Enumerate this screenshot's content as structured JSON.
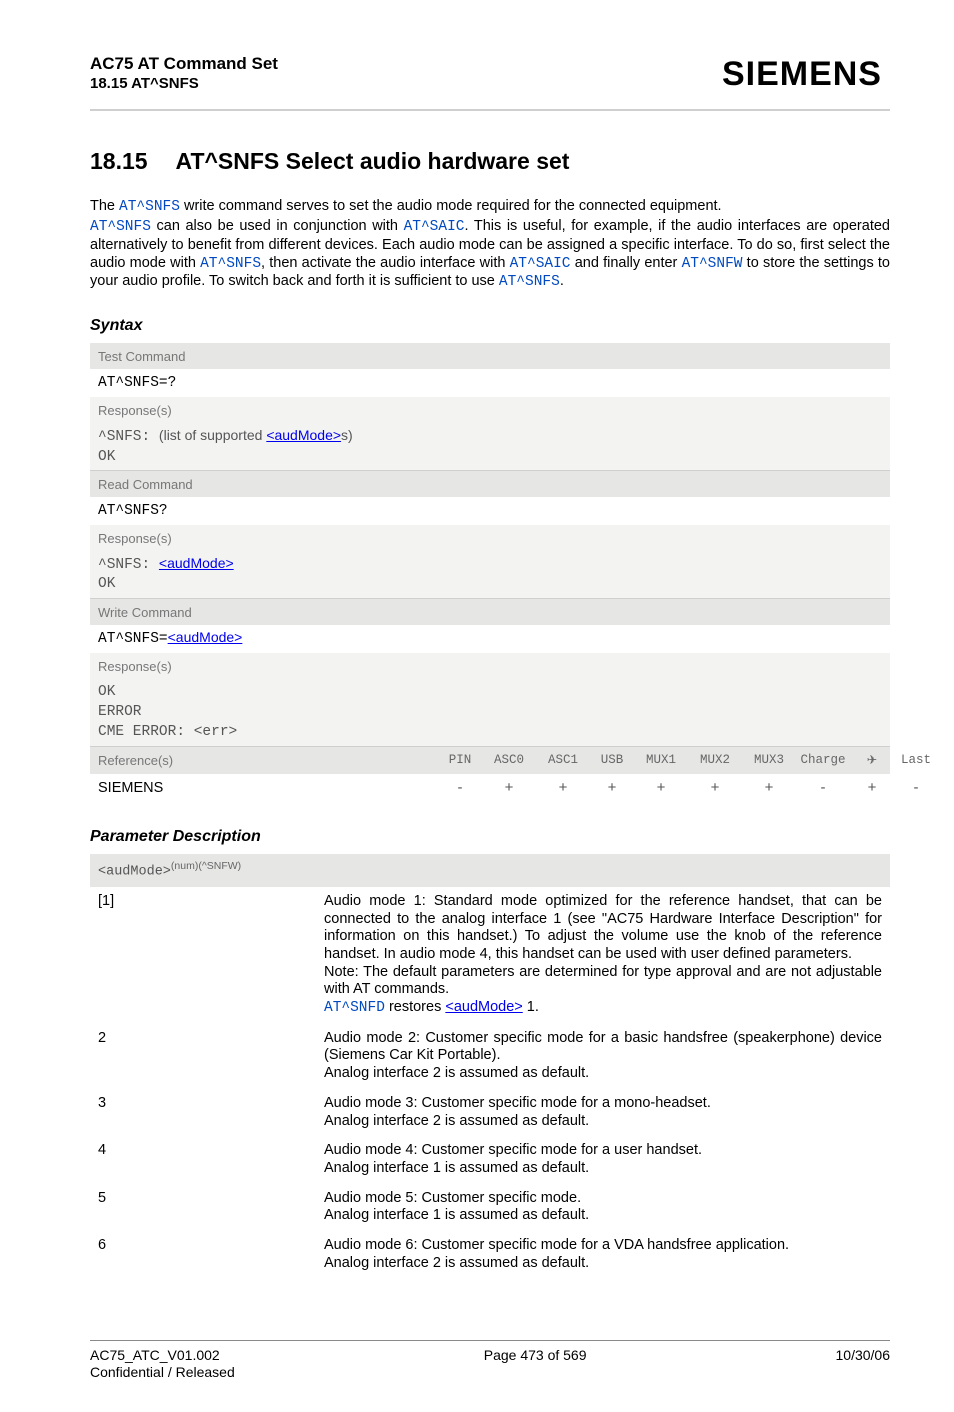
{
  "header": {
    "doc_title": "AC75 AT Command Set",
    "doc_sub": "18.15 AT^SNFS",
    "brand": "SIEMENS"
  },
  "section": {
    "number": "18.15",
    "title": "AT^SNFS   Select audio hardware set"
  },
  "intro": {
    "t1a": "The ",
    "cmd1": "AT^SNFS",
    "t1b": " write command serves to set the audio mode required for the connected equipment.",
    "cmd2": "AT^SNFS",
    "t2b": " can also be used in conjunction with ",
    "cmd3": "AT^SAIC",
    "t2c": ". This is useful, for example, if the audio interfaces are operated alternatively to benefit from different devices. Each audio mode can be assigned a specific interface. To do so, first select the audio mode with ",
    "cmd4": "AT^SNFS",
    "t2d": ", then activate the audio interface with ",
    "cmd5": "AT^SAIC",
    "t2e": " and finally enter ",
    "cmd6": "AT^SNFW",
    "t2f": " to store the settings to your audio profile. To switch back and forth it is sufficient to use ",
    "cmd7": "AT^SNFS",
    "t2g": "."
  },
  "labels": {
    "syntax": "Syntax",
    "test_cmd": "Test Command",
    "read_cmd": "Read Command",
    "write_cmd": "Write Command",
    "responses": "Response(s)",
    "references": "Reference(s)",
    "param_desc": "Parameter Description"
  },
  "syntax": {
    "test_cmd": "AT^SNFS=?",
    "test_resp_pre": "^SNFS: ",
    "test_resp_mid1": "(list of supported ",
    "test_resp_param": "<audMode>",
    "test_resp_mid2": "s)",
    "ok": "OK",
    "read_cmd": "AT^SNFS?",
    "read_resp_pre": "^SNFS: ",
    "read_resp_param": "<audMode>",
    "write_cmd_pre": "AT^SNFS=",
    "write_cmd_param": "<audMode>",
    "error": "ERROR",
    "cme_pre": "CME ERROR: ",
    "cme_err": "<err>"
  },
  "matrix": {
    "cols": [
      "PIN",
      "ASC0",
      "ASC1",
      "USB",
      "MUX1",
      "MUX2",
      "MUX3",
      "Charge",
      "✈",
      "Last"
    ],
    "ref_value": "SIEMENS",
    "vals": [
      "-",
      "+",
      "+",
      "+",
      "+",
      "+",
      "+",
      "-",
      "+",
      "-"
    ]
  },
  "pd": {
    "head_param": "<audMode>",
    "head_sup": "(num)(^SNFW)",
    "rows": [
      {
        "key": "[1]",
        "desc_plain_a": "Audio mode 1: Standard mode optimized for the reference handset, that can be connected to the analog interface 1 (see \"AC75 Hardware Interface Description\" for information on this handset.) To adjust the volume use the knob of the reference handset. In audio mode 4, this handset can be used with user defined parameters.",
        "desc_plain_b": "Note: The default parameters are determined for type approval and are not adjustable with AT commands.",
        "cmd": "AT^SNFD",
        "mid": " restores ",
        "param": "<audMode>",
        "tail": " 1."
      },
      {
        "key": "2",
        "desc_a": "Audio mode 2: Customer specific mode for a basic handsfree (speakerphone) device (Siemens Car Kit Portable).",
        "desc_b": "Analog interface 2 is assumed as default."
      },
      {
        "key": "3",
        "desc_a": "Audio mode 3: Customer specific mode for a mono-headset.",
        "desc_b": "Analog interface 2 is assumed as default."
      },
      {
        "key": "4",
        "desc_a": "Audio mode 4: Customer specific mode for a user handset.",
        "desc_b": "Analog interface 1 is assumed as default."
      },
      {
        "key": "5",
        "desc_a": "Audio mode 5: Customer specific mode.",
        "desc_b": "Analog interface 1 is assumed as default."
      },
      {
        "key": "6",
        "desc_a": "Audio mode 6: Customer specific mode for a VDA handsfree application.",
        "desc_b": "Analog interface 2 is assumed as default."
      }
    ]
  },
  "footer": {
    "left1": "AC75_ATC_V01.002",
    "left2": "Confidential / Released",
    "center": "Page 473 of 569",
    "right": "10/30/06"
  }
}
